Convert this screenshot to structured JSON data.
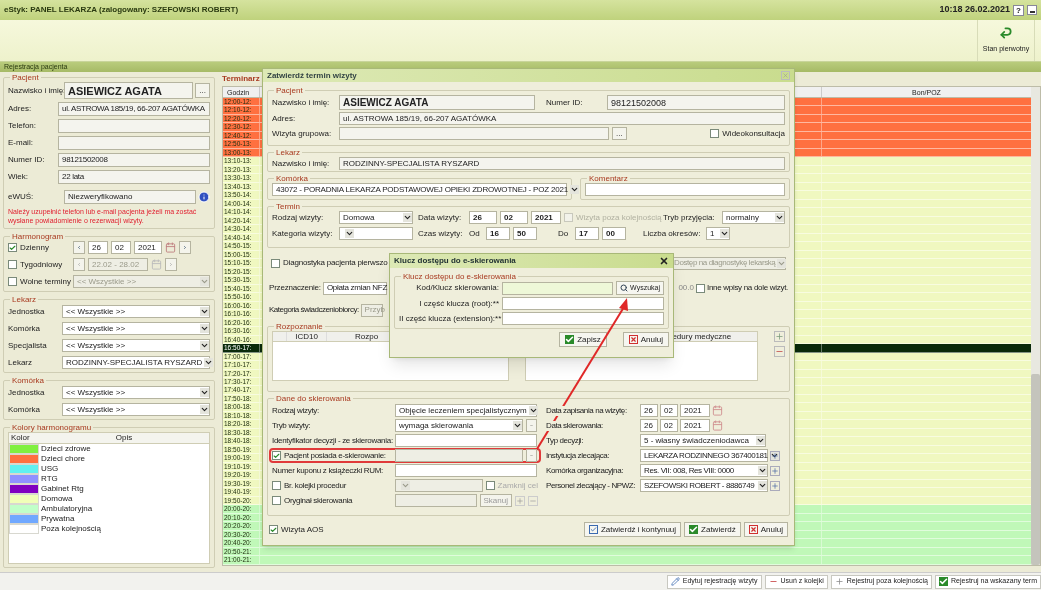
{
  "window": {
    "title": "eStyk: PANEL LEKARZA (zalogowany: SZEFOWSKI ROBERT)",
    "clock": "10:18 26.02.2021",
    "help": "?"
  },
  "ribbon": {
    "buttons": [
      {
        "label": "Stan pierwotny"
      }
    ]
  },
  "section_title": "Rejestracja pacjenta",
  "patient_panel": {
    "legend": "Pacjent",
    "fields": [
      {
        "label": "Nazwisko i imię:",
        "value": "ASIEWICZ AGATA",
        "kind": "name",
        "button": "..."
      },
      {
        "label": "Adres:",
        "value": "ul. ASTROWA 185/19, 66-207 AGATÓWKA",
        "kind": "text"
      },
      {
        "label": "Telefon:",
        "kind": "text"
      },
      {
        "label": "E-mail:",
        "kind": "text"
      },
      {
        "label": "Numer ID:",
        "value": "98121502008",
        "kind": "text"
      },
      {
        "label": "Wiek:",
        "value": "22 lata",
        "kind": "text"
      },
      {
        "label": "eWUŚ:",
        "value": "Niezweryfikowano",
        "kind": "status"
      }
    ],
    "warning": "Należy uzupełnić telefon lub e-mail pacjenta jeżeli ma zostać wysłane powiadomienie o rezerwacji wizyty."
  },
  "schedule_filter": {
    "legend": "Harmonogram",
    "options": [
      {
        "label": "Dzienny",
        "checked": true,
        "kind": "date",
        "value": [
          "26",
          "02",
          "2021"
        ]
      },
      {
        "label": "Tygodniowy",
        "checked": false,
        "kind": "week",
        "value": [
          "22.02 - 28.02"
        ]
      },
      {
        "label": "Wolne terminy",
        "checked": false,
        "kind": "select",
        "value": [
          "<< Wszystkie >>"
        ]
      }
    ]
  },
  "doctor_filter": {
    "legend": "Lekarz",
    "fields": [
      {
        "label": "Jednostka",
        "value": "<< Wszystkie >>"
      },
      {
        "label": "Komórka",
        "value": "<< Wszystkie >>"
      },
      {
        "label": "Specjalista",
        "value": "<< Wszystkie >>"
      },
      {
        "label": "Lekarz",
        "value": "RODZINNY-SPECJALISTA RYSZARD"
      }
    ]
  },
  "unit_filter": {
    "legend": "Komórka",
    "fields": [
      {
        "label": "Jednostka",
        "value": "<< Wszystkie >>"
      },
      {
        "label": "Komórka",
        "value": "<< Wszystkie >>"
      }
    ]
  },
  "color_legend": {
    "legend": "Kolory harmonogramu",
    "columns": [
      "Kolor",
      "Opis"
    ],
    "rows": [
      {
        "label": "Dzieci zdrowe",
        "color": "#80f040"
      },
      {
        "label": "Dzieci chore",
        "color": "#ff7040"
      },
      {
        "label": "USG",
        "color": "#60f0f0"
      },
      {
        "label": "RTG",
        "color": "#9090ff"
      },
      {
        "label": "Gabinet Rtg",
        "color": "#8000c0"
      },
      {
        "label": "Domowa",
        "color": "#f0ffb8"
      },
      {
        "label": "Ambulatoryjna",
        "color": "#c0ffc8"
      },
      {
        "label": "Prywatna",
        "color": "#70a8ff"
      },
      {
        "label": "Poza kolejnością",
        "color": "#ffffff"
      }
    ]
  },
  "schedule": {
    "title": "Terminarz",
    "columns": [
      "Godzin",
      "Bon/POZ"
    ],
    "rows": [
      {
        "time": "12:00-12:",
        "color": "#ff7040",
        "selected": false
      },
      {
        "time": "12:10-12:",
        "color": "#ff7040",
        "selected": false
      },
      {
        "time": "12:20-12:",
        "color": "#ff7040",
        "selected": false
      },
      {
        "time": "12:30-12:",
        "color": "#ff7040",
        "selected": false
      },
      {
        "time": "12:40-12:",
        "color": "#ff7040",
        "selected": false
      },
      {
        "time": "12:50-13:",
        "color": "#ff7040",
        "selected": false
      },
      {
        "time": "13:00-13:",
        "color": "#ff7040",
        "selected": false
      },
      {
        "time": "13:10-13:",
        "color": "#f0f8c0",
        "selected": false
      },
      {
        "time": "13:20-13:",
        "color": "#f0f8c0",
        "selected": false
      },
      {
        "time": "13:30-13:",
        "color": "#f0f8c0",
        "selected": false
      },
      {
        "time": "13:40-13:",
        "color": "#f0f8c0",
        "selected": false
      },
      {
        "time": "13:50-14:",
        "color": "#f0f8c0",
        "selected": false
      },
      {
        "time": "14:00-14:",
        "color": "#f0f8c0",
        "selected": false
      },
      {
        "time": "14:10-14:",
        "color": "#f0f8c0",
        "selected": false
      },
      {
        "time": "14:20-14:",
        "color": "#f0f8c0",
        "selected": false
      },
      {
        "time": "14:30-14:",
        "color": "#f0f8c0",
        "selected": false
      },
      {
        "time": "14:40-14:",
        "color": "#f0f8c0",
        "selected": false
      },
      {
        "time": "14:50-15:",
        "color": "#f0f8c0",
        "selected": false
      },
      {
        "time": "15:00-15:",
        "color": "#f0f8c0",
        "selected": false
      },
      {
        "time": "15:10-15:",
        "color": "#f0f8c0",
        "selected": false
      },
      {
        "time": "15:20-15:",
        "color": "#f0f8c0",
        "selected": false
      },
      {
        "time": "15:30-15:",
        "color": "#f0f8c0",
        "selected": false
      },
      {
        "time": "15:40-15:",
        "color": "#f0f8c0",
        "selected": false
      },
      {
        "time": "15:50-16:",
        "color": "#f0f8c0",
        "selected": false
      },
      {
        "time": "16:00-16:",
        "color": "#f0f8c0",
        "selected": false
      },
      {
        "time": "16:10-16:",
        "color": "#f0f8c0",
        "selected": false
      },
      {
        "time": "16:20-16:",
        "color": "#f0f8c0",
        "selected": false
      },
      {
        "time": "16:30-16:",
        "color": "#f0f8c0",
        "selected": false
      },
      {
        "time": "16:40-16:",
        "color": "#f0f8c0",
        "selected": false
      },
      {
        "time": "16:50-17:",
        "selected": true
      },
      {
        "time": "17:00-17:",
        "color": "#f0f8c0",
        "selected": false
      },
      {
        "time": "17:10-17:",
        "color": "#f0f8c0",
        "selected": false
      },
      {
        "time": "17:20-17:",
        "color": "#f0f8c0",
        "selected": false
      },
      {
        "time": "17:30-17:",
        "color": "#f0f8c0",
        "selected": false
      },
      {
        "time": "17:40-17:",
        "color": "#f0f8c0",
        "selected": false
      },
      {
        "time": "17:50-18:",
        "color": "#f0f8c0",
        "selected": false
      },
      {
        "time": "18:00-18:",
        "color": "#f0f8c0",
        "selected": false
      },
      {
        "time": "18:10-18:",
        "color": "#f0f8c0",
        "selected": false
      },
      {
        "time": "18:20-18:",
        "color": "#f0f8c0",
        "selected": false
      },
      {
        "time": "18:30-18:",
        "color": "#f0f8c0",
        "selected": false
      },
      {
        "time": "18:40-18:",
        "color": "#f0f8c0",
        "selected": false
      },
      {
        "time": "18:50-19:",
        "color": "#f0f8c0",
        "selected": false
      },
      {
        "time": "19:00-19:",
        "color": "#f0f8c0",
        "selected": false
      },
      {
        "time": "19:10-19:",
        "color": "#f0f8c0",
        "selected": false
      },
      {
        "time": "19:20-19:",
        "color": "#f0f8c0",
        "selected": false
      },
      {
        "time": "19:30-19:",
        "color": "#f0f8c0",
        "selected": false
      },
      {
        "time": "19:40-19:",
        "color": "#f0f8c0",
        "selected": false
      },
      {
        "time": "19:50-20:",
        "color": "#f0f8c0",
        "selected": false
      },
      {
        "time": "20:00-20:",
        "color": "#c0f8b8",
        "selected": false
      },
      {
        "time": "20:10-20:",
        "color": "#c0f8b8",
        "selected": false
      },
      {
        "time": "20:20-20:",
        "color": "#c0f8b8",
        "selected": false
      },
      {
        "time": "20:30-20:",
        "color": "#c0f8b8",
        "selected": false
      },
      {
        "time": "20:40-20:",
        "color": "#c0f8b8",
        "selected": false
      },
      {
        "time": "20:50-21:",
        "color": "#c0f8b8",
        "selected": false
      },
      {
        "time": "21:00-21:",
        "color": "#c0f8b8",
        "selected": false
      }
    ]
  },
  "dialog": {
    "title": "Zatwierdź termin wizyty",
    "patient": {
      "legend": "Pacjent",
      "name_label": "Nazwisko i imię:",
      "name": "ASIEWICZ AGATA",
      "id_label": "Numer ID:",
      "id": "98121502008",
      "address_label": "Adres:",
      "address": "ul. ASTROWA 185/19, 66-207 AGATÓWKA",
      "group_label": "Wizyta grupowa:",
      "group_button": "...",
      "video": {
        "label": "Wideokonsultacja",
        "checked": false
      }
    },
    "doctor": {
      "legend": "Lekarz",
      "name_label": "Nazwisko i imię:",
      "name": "RODZINNY-SPECJALISTA RYSZARD"
    },
    "unit": {
      "legend": "Komórka",
      "value": "43072 - PORADNIA LEKARZA PODSTAWOWEJ OPIEKI ZDROWOTNEJ - POZ 2021"
    },
    "comment": {
      "legend": "Komentarz"
    },
    "term": {
      "legend": "Termin",
      "visit_type_label": "Rodzaj wizyty:",
      "visit_type": "Domowa",
      "date_label": "Data wizyty:",
      "date": [
        "26",
        "02",
        "2021"
      ],
      "out_of_queue": {
        "label": "Wizyta poza kolejnością",
        "checked": false,
        "disabled": true
      },
      "mode_label": "Tryb przyjęcia:",
      "mode": "normalny",
      "category_label": "Kategoria wizyty:",
      "time_label": "Czas wizyty:",
      "from_label": "Od",
      "from": [
        "16",
        "50"
      ],
      "to_label": "Do",
      "to": [
        "17",
        "00"
      ],
      "periods_label": "Liczba okresów:",
      "periods": "1"
    },
    "diagnostics": {
      "label": "Diagnostyka pacjenta pierwszo",
      "checked": false,
      "select": "Dostęp na diagnostykę lekarską"
    },
    "purpose": {
      "label": "Przeznaczenie:",
      "value": "Opłata zmian NFZ",
      "price": "00.0",
      "extra": {
        "label": "Inne wpisy na dole wizyt.",
        "checked": false
      }
    },
    "beneficiary": {
      "label": "Kategoria świadczeniobiorcy:",
      "value": "Przyb"
    },
    "diagnosis": {
      "legend": "Rozpoznanie",
      "left_columns": [
        "ICD10",
        "Rozpo"
      ],
      "right_column": "edury medyczne"
    },
    "referral": {
      "legend": "Dane do skierowania",
      "left": [
        {
          "kind": "select",
          "label": "Rodzaj wizyty:",
          "value": "Objęcie leczeniem specjalistycznym"
        },
        {
          "kind": "select_more",
          "label": "Tryb wizyty:",
          "value": "wymaga skierowania"
        },
        {
          "kind": "input",
          "label": "Identyfikator decyzji - ze skierowania:"
        },
        {
          "kind": "check_more",
          "label": "Pacjent posiada e-skierowanie:",
          "checked": true,
          "highlighted": true
        },
        {
          "kind": "input",
          "label": "Numer kuponu z książeczki RUM:"
        },
        {
          "kind": "check_select",
          "label": "Br. kolejki procedur",
          "checked": false,
          "extra": "Zamknij cel"
        },
        {
          "kind": "check_scan",
          "label": "Oryginał skierowania",
          "checked": false,
          "button": "Skanuj"
        }
      ],
      "right": [
        {
          "kind": "date",
          "label": "Data zapisania na wizytę:",
          "value": [
            "26",
            "02",
            "2021"
          ]
        },
        {
          "kind": "date",
          "label": "Data skierowania:",
          "value": [
            "26",
            "02",
            "2021"
          ]
        },
        {
          "kind": "select",
          "label": "Typ decyzji:",
          "value": "5 - własny świadczeniodawca"
        },
        {
          "kind": "select_add",
          "label": "Instytucja zlecająca:",
          "value": "LEKARZA RODZINNEGO 367400181"
        },
        {
          "kind": "select_add",
          "label": "Komórka organizacyjna:",
          "value": "Res. VII: 008, Res VIII: 0000"
        },
        {
          "kind": "select_add",
          "label": "Personel zlecający - NPWZ:",
          "value": "SZEFOWSKI ROBERT - 8886749"
        }
      ]
    },
    "aos": {
      "label": "Wizyta AOS",
      "checked": true
    },
    "buttons": [
      {
        "label": "Zatwierdź i kontynuuj",
        "kind": "continue"
      },
      {
        "label": "Zatwierdź",
        "kind": "ok"
      },
      {
        "label": "Anuluj",
        "kind": "cancel"
      }
    ]
  },
  "key_dialog": {
    "title": "Klucz dostępu do e-skierowania",
    "legend": "Klucz dostępu do e-skierowania",
    "fields": [
      {
        "label": "Kod/Klucz skierowania:",
        "button": "Wyszukaj"
      },
      {
        "label": "I część klucza (root):**"
      },
      {
        "label": "II część klucza (extension):**"
      }
    ],
    "buttons": [
      {
        "label": "Zapisz",
        "kind": "ok"
      },
      {
        "label": "Anuluj",
        "kind": "cancel"
      }
    ]
  },
  "status_bar": {
    "buttons": [
      {
        "label": "Edytuj rejestrację wizyty",
        "kind": "edit"
      },
      {
        "label": "Usuń z kolejki",
        "kind": "remove"
      },
      {
        "label": "Rejestruj poza kolejnością",
        "kind": "outside"
      },
      {
        "label": "Rejestruj na wskazany term",
        "kind": "ok"
      }
    ]
  }
}
